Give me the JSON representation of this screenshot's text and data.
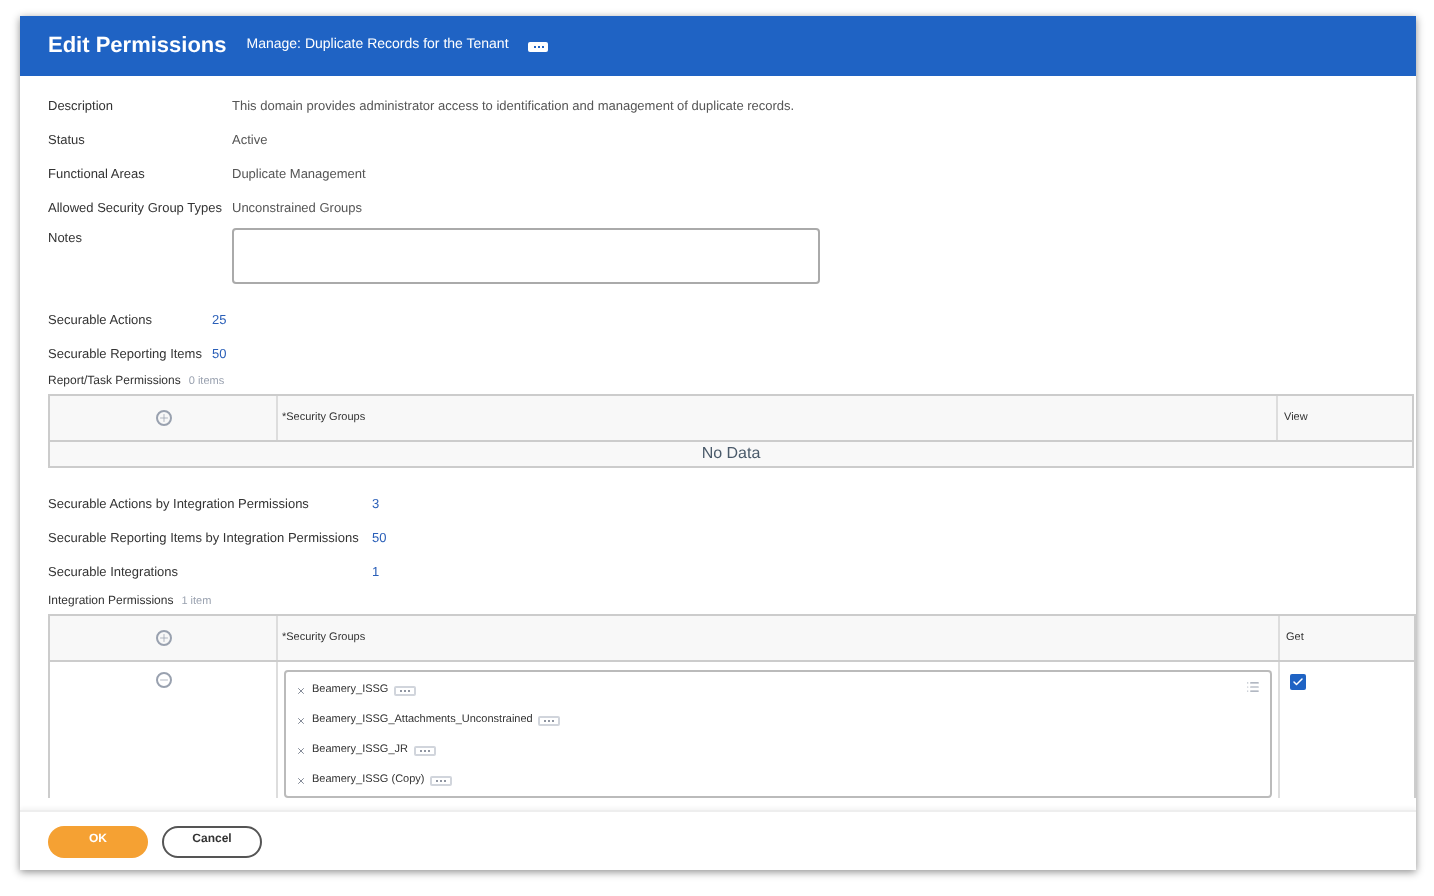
{
  "header": {
    "title": "Edit Permissions",
    "subtitle": "Manage: Duplicate Records for the Tenant"
  },
  "fields": [
    {
      "label": "Description",
      "value": "This domain provides administrator access to identification and management of duplicate records."
    },
    {
      "label": "Status",
      "value": "Active"
    },
    {
      "label": "Functional Areas",
      "value": "Duplicate Management"
    },
    {
      "label": "Allowed Security Group Types",
      "value": "Unconstrained Groups"
    }
  ],
  "notes": {
    "label": "Notes"
  },
  "counts": [
    {
      "label": "Securable Actions",
      "value": "25"
    },
    {
      "label": "Securable Reporting Items",
      "value": "50"
    }
  ],
  "report_task_permissions": {
    "title": "Report/Task Permissions",
    "count": "0 items",
    "columns": [
      "*Security Groups",
      "View"
    ],
    "empty_text": "No Data"
  },
  "integration_counts": [
    {
      "label": "Securable Actions by Integration Permissions",
      "value": "3"
    },
    {
      "label": "Securable Reporting Items by Integration Permissions",
      "value": "50"
    },
    {
      "label": "Securable Integrations",
      "value": "1"
    }
  ],
  "integration_permissions": {
    "title": "Integration Permissions",
    "count": "1 item",
    "columns": [
      "*Security Groups",
      "Get"
    ],
    "rows": [
      {
        "groups": [
          "Beamery_ISSG",
          "Beamery_ISSG_Attachments_Unconstrained",
          "Beamery_ISSG_JR",
          "Beamery_ISSG (Copy)"
        ],
        "get": true
      }
    ]
  },
  "buttons": [
    {
      "label": "OK",
      "kind": "primary"
    },
    {
      "label": "Cancel",
      "kind": "secondary"
    }
  ]
}
